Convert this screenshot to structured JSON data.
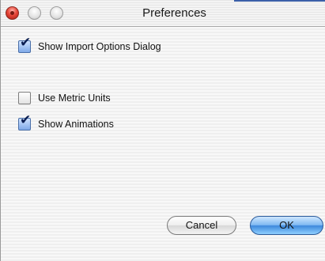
{
  "window": {
    "title": "Preferences",
    "controls": {
      "close": "close-icon",
      "minimize": "minimize-icon",
      "zoom": "zoom-icon"
    }
  },
  "options": [
    {
      "label": "Show Import Options Dialog",
      "checked": true
    },
    {
      "label": "Use Metric Units",
      "checked": false
    },
    {
      "label": "Show Animations",
      "checked": true
    }
  ],
  "buttons": {
    "cancel_label": "Cancel",
    "ok_label": "OK"
  },
  "colors": {
    "accent": "#3d88dc",
    "close": "#e8483a"
  }
}
